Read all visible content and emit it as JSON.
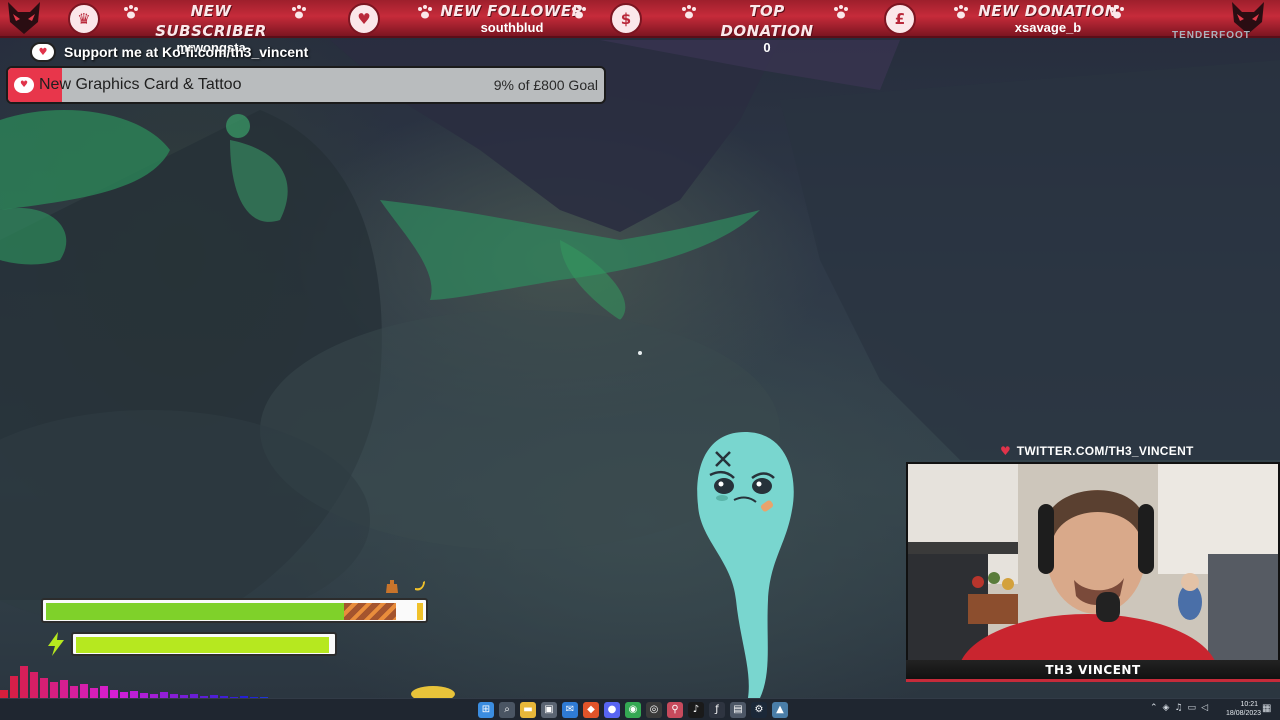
{
  "alert_bar": {
    "segments": [
      {
        "label": "NEW SUBSCRIBER",
        "value": "mrwongsta",
        "icon": "crown-icon"
      },
      {
        "label": "NEW FOLLOWER",
        "value": "southblud",
        "icon": "heart-icon"
      },
      {
        "label": "TOP DONATION",
        "value": "0",
        "icon": "money-bag-icon"
      },
      {
        "label": "NEW DONATION",
        "value": "xsavage_b",
        "icon": "pound-bag-icon"
      }
    ],
    "brand": "TENDERFOOT",
    "colors": {
      "bar": "#c62b3a",
      "text": "#ffffff"
    }
  },
  "kofi": {
    "text": "Support me at Ko-fi.com/th3_vincent"
  },
  "goal": {
    "title": "New Graphics Card & Tattoo",
    "progress_text": "9% of £800 Goal",
    "progress": 0.09
  },
  "webcam": {
    "twitter": "TWITTER.COM/TH3_VINCENT",
    "name": "TH3 VINCENT"
  },
  "hud": {
    "health_fill": 0.84,
    "health_stripe": 0.14,
    "energy_fill": 0.99,
    "colors": {
      "health": "#7fd12a",
      "energy": "#b6e81f"
    }
  },
  "taskbar": {
    "apps": [
      "windows-start-icon",
      "search-icon",
      "file-explorer-icon",
      "store-icon",
      "mail-icon",
      "brave-icon",
      "discord-icon",
      "chrome-icon",
      "obs-icon",
      "maps-icon",
      "tiktok-icon",
      "tf-icon",
      "shop-icon",
      "steam-icon",
      "game-icon"
    ],
    "time": "10:21",
    "date": "18/08/2023"
  }
}
